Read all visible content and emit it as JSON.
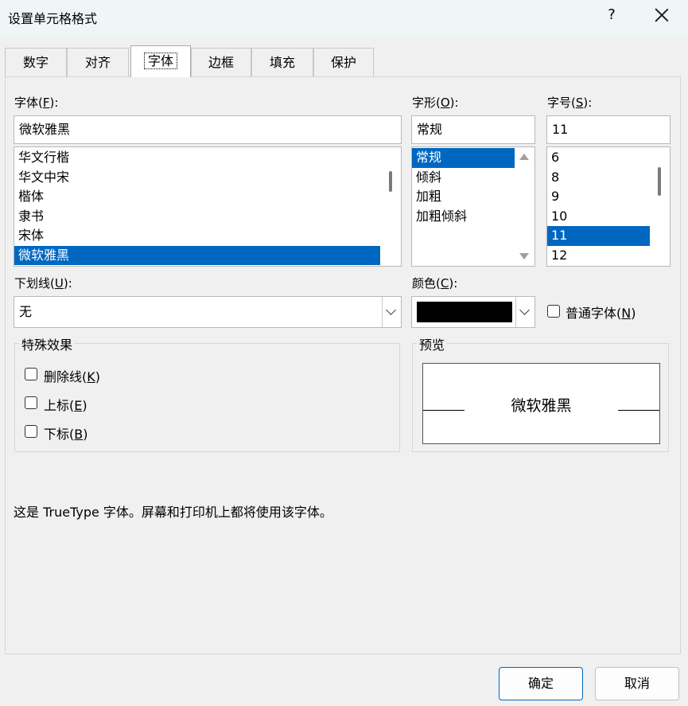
{
  "title": "设置单元格格式",
  "help_label": "?",
  "tabs": [
    "数字",
    "对齐",
    "字体",
    "边框",
    "填充",
    "保护"
  ],
  "font": {
    "label": "字体(",
    "key": "F",
    "suffix": "):",
    "value": "微软雅黑",
    "items": [
      "华文行楷",
      "华文中宋",
      "楷体",
      "隶书",
      "宋体",
      "微软雅黑"
    ],
    "selected": 5
  },
  "style": {
    "label": "字形(",
    "key": "O",
    "suffix": "):",
    "value": "常规",
    "items": [
      "常规",
      "倾斜",
      "加粗",
      "加粗倾斜"
    ],
    "selected": 0
  },
  "size": {
    "label": "字号(",
    "key": "S",
    "suffix": "):",
    "value": "11",
    "items": [
      "6",
      "8",
      "9",
      "10",
      "11",
      "12"
    ],
    "selected": 4
  },
  "underline": {
    "label": "下划线(",
    "key": "U",
    "suffix": "):",
    "value": "无"
  },
  "color": {
    "label": "颜色(",
    "key": "C",
    "suffix": "):",
    "swatch": "#000000"
  },
  "normal_font": {
    "label": "普通字体(",
    "key": "N",
    "suffix": ")"
  },
  "effects": {
    "title": "特殊效果",
    "strikethrough": {
      "label": "删除线(",
      "key": "K",
      "suffix": ")"
    },
    "superscript": {
      "label": "上标(",
      "key": "E",
      "suffix": ")"
    },
    "subscript": {
      "label": "下标(",
      "key": "B",
      "suffix": ")"
    }
  },
  "preview": {
    "title": "预览",
    "text": "微软雅黑"
  },
  "note": "这是 TrueType 字体。屏幕和打印机上都将使用该字体。",
  "buttons": {
    "ok": "确定",
    "cancel": "取消"
  },
  "colors": {
    "accent": "#0067c0",
    "title_bg": "#eef6f7"
  }
}
